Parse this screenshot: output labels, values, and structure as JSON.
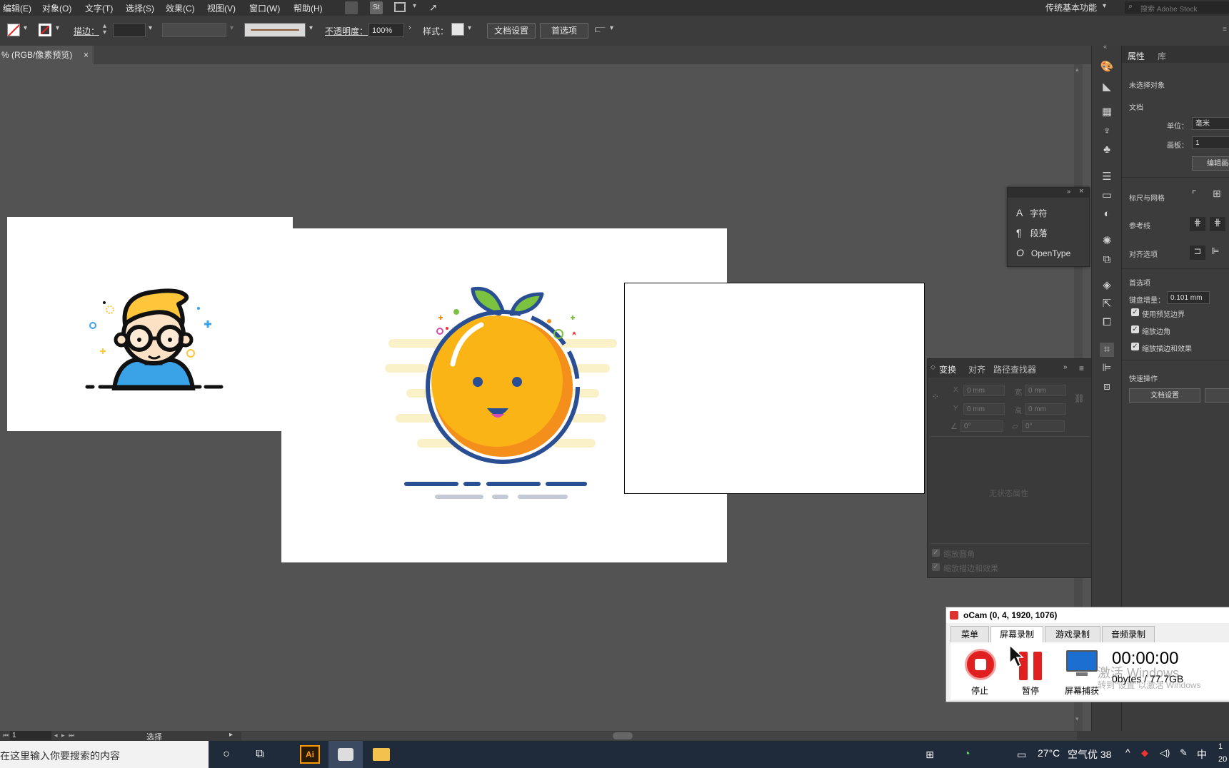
{
  "menubar": {
    "items": [
      "编辑(E)",
      "对象(O)",
      "文字(T)",
      "选择(S)",
      "效果(C)",
      "视图(V)",
      "窗口(W)",
      "帮助(H)"
    ],
    "workspace": "传统基本功能",
    "stock_search_placeholder": "搜索 Adobe Stock",
    "st_label": "St"
  },
  "controlbar": {
    "stroke_label": "描边：",
    "opacity_label": "不透明度：",
    "opacity_value": "100%",
    "style_label": "样式：",
    "doc_setup_button": "文档设置",
    "preferences_button": "首选项"
  },
  "document_tab": {
    "title": "% (RGB/像素预览)",
    "close": "×"
  },
  "char_panel": {
    "items": [
      {
        "icon": "A",
        "label": "字符"
      },
      {
        "icon": "¶",
        "label": "段落"
      },
      {
        "icon": "O",
        "label": "OpenType"
      }
    ]
  },
  "transform_panel": {
    "tabs": [
      "变换",
      "对齐",
      "路径查找器"
    ],
    "x_label": "X",
    "x_value": "0 mm",
    "y_label": "Y",
    "y_value": "0 mm",
    "w_label": "宽",
    "w_value": "0 mm",
    "h_label": "高",
    "h_value": "0 mm",
    "angle_value": "0°",
    "shear_value": "0°",
    "no_state": "无状态属性",
    "scale_corners": "缩放圆角",
    "scale_strokes": "缩放描边和效果"
  },
  "properties_panel": {
    "tabs": [
      "属性",
      "库"
    ],
    "no_selection": "未选择对象",
    "document_section": "文档",
    "units_label": "单位：",
    "units_value": "毫米",
    "artboard_label": "画板：",
    "artboard_value": "1",
    "edit_artboard_button": "编辑画板",
    "rulers_grids": "标尺与网格",
    "guides": "参考线",
    "snap_options": "对齐选项",
    "preferences": "首选项",
    "keyboard_increment_label": "键盘增量：",
    "keyboard_increment_value": "0.101 mm",
    "use_preview_bounds": "使用预览边界",
    "scale_corners": "缩放边角",
    "scale_strokes": "缩放描边和效果",
    "quick_actions": "快速操作",
    "doc_setup_button": "文档设置"
  },
  "ocam": {
    "title": "oCam (0, 4, 1920, 1076)",
    "tabs": [
      "菜单",
      "屏幕录制",
      "游戏录制",
      "音频录制"
    ],
    "stop_label": "停止",
    "pause_label": "暂停",
    "capture_label": "屏幕捕获",
    "timer": "00:00:00",
    "storage": "0bytes / 77.7GB",
    "watermark1": "激活 Windows",
    "watermark2": "转到\"设置\"以激活 Windows"
  },
  "statusbar": {
    "zoom_value": "1",
    "tool_label": "选择"
  },
  "taskbar": {
    "search_placeholder": "在这里输入你要搜索的内容",
    "ai_label": "Ai",
    "temperature": "27°C",
    "air_quality": "空气优 38",
    "ime": "中",
    "clock_line1": "1",
    "clock_line2": "20"
  },
  "colors": {
    "orange": "#fbb416",
    "orange_dark": "#f48f1b",
    "navy": "#2a4e93",
    "leaf_green": "#7cc241",
    "boy_shirt": "#3aa2e6",
    "boy_hair": "#ffc53b",
    "stop_red": "#e02020"
  }
}
